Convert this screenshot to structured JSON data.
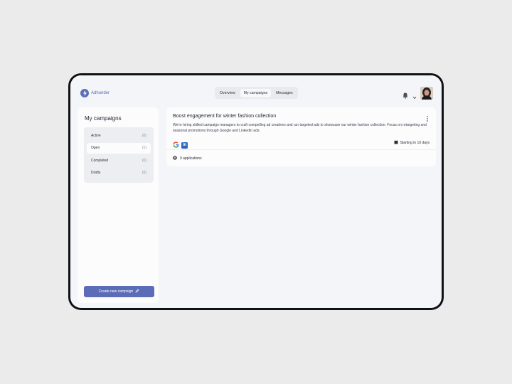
{
  "brand": {
    "name": "Adhunder",
    "logo": "bolt-icon",
    "accent_color": "#5b6db7"
  },
  "nav": {
    "items": [
      {
        "label": "Overview"
      },
      {
        "label": "My campaigns"
      },
      {
        "label": "Messages"
      }
    ],
    "active": "My campaigns"
  },
  "header": {
    "notifications_icon": "bell-icon",
    "menu_icon": "chevron-down-icon",
    "avatar": "user-avatar"
  },
  "sidebar": {
    "title": "My campaigns",
    "statuses": [
      {
        "label": "Active",
        "count": "(0)"
      },
      {
        "label": "Open",
        "count": "(1)"
      },
      {
        "label": "Completed",
        "count": "(0)"
      },
      {
        "label": "Drafts",
        "count": "(0)"
      }
    ],
    "selected": "Open",
    "create_label": "Create new campaign"
  },
  "campaign": {
    "title": "Boost engagement for winter fashion collection",
    "description": "We're hiring skilled campaign managers to craft compelling ad creatives and run targeted ads to showcase our winter fashion collection. Focus on retargeting and seasonal promotions through Google and LinkedIn ads.",
    "channels": [
      "google-icon",
      "linkedin-icon"
    ],
    "start": "Starting in 10 days",
    "applications": "0 applications"
  }
}
